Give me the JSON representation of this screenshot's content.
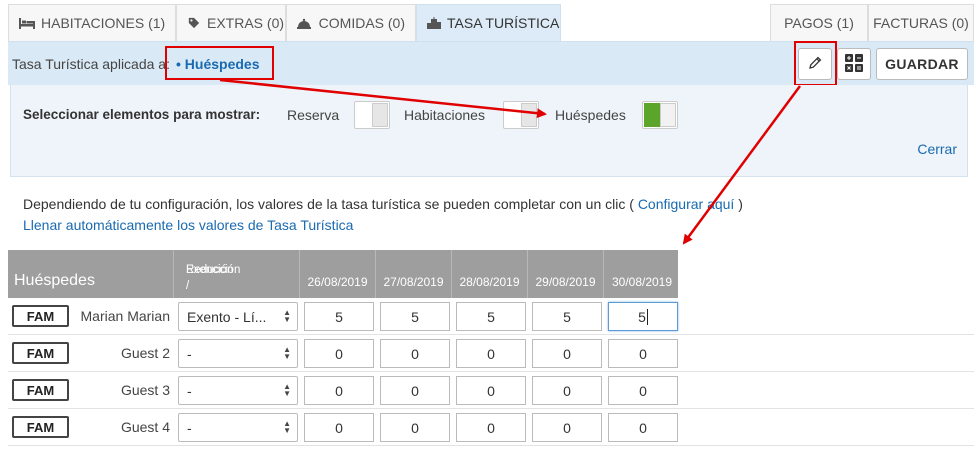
{
  "tabs": [
    {
      "label": "HABITACIONES (1)",
      "icon": "bed-icon"
    },
    {
      "label": "EXTRAS (0)",
      "icon": "tag-icon"
    },
    {
      "label": "COMIDAS (0)",
      "icon": "cloche-icon"
    },
    {
      "label": "TASA TURÍSTICA",
      "icon": "building-icon",
      "active": true
    },
    {
      "label": "PAGOS (1)"
    },
    {
      "label": "FACTURAS (0)"
    }
  ],
  "tourist_tax": {
    "applied_label": "Tasa Turística aplicada a:",
    "applied_value": "• Huéspedes",
    "save_label": "GUARDAR"
  },
  "selector": {
    "label": "Seleccionar elementos para mostrar:",
    "options": [
      {
        "label": "Reserva",
        "on": false
      },
      {
        "label": "Habitaciones",
        "on": false
      },
      {
        "label": "Huéspedes",
        "on": true
      }
    ],
    "close_label": "Cerrar"
  },
  "info": {
    "text": "Dependiendo de tu configuración, los valores de la tasa turística se pueden completar con un clic (",
    "config_link": "Configurar aquí",
    "text_end": ")",
    "autofill_link": "Llenar automáticamente los valores de Tasa Turística"
  },
  "table": {
    "col_guests": "Huéspedes",
    "col_reduction_1": "Reducción /",
    "col_reduction_2": "Exención",
    "dates": [
      "26/08/2019",
      "27/08/2019",
      "28/08/2019",
      "29/08/2019",
      "30/08/2019"
    ],
    "rows": [
      {
        "badge": "FAM",
        "name": "Marian Marian",
        "reduction": "Exento - Lí...",
        "values": [
          "5",
          "5",
          "5",
          "5",
          "5"
        ]
      },
      {
        "badge": "FAM",
        "name": "Guest 2",
        "reduction": "-",
        "values": [
          "0",
          "0",
          "0",
          "0",
          "0"
        ]
      },
      {
        "badge": "FAM",
        "name": "Guest 3",
        "reduction": "-",
        "values": [
          "0",
          "0",
          "0",
          "0",
          "0"
        ]
      },
      {
        "badge": "FAM",
        "name": "Guest 4",
        "reduction": "-",
        "values": [
          "0",
          "0",
          "0",
          "0",
          "0"
        ]
      }
    ]
  },
  "colors": {
    "accent": "#1a6ab0",
    "highlight": "#e00000",
    "toggle_on": "#5aa52a"
  }
}
